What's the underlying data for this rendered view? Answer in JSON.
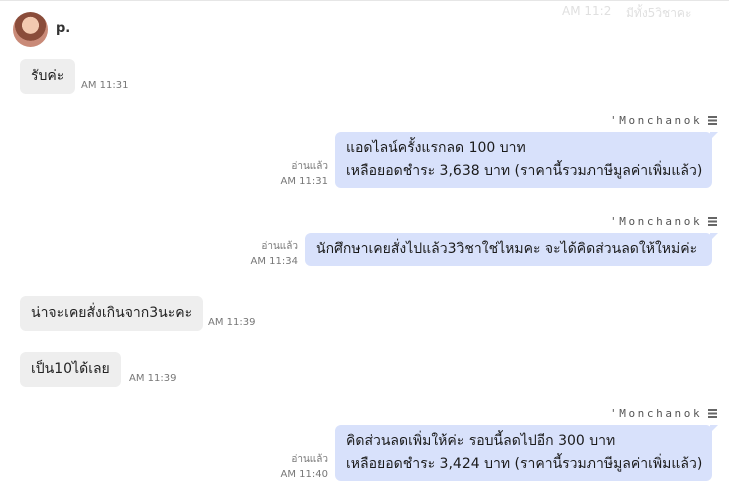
{
  "contact": {
    "name": "p."
  },
  "header_ghost": {
    "left_text": "AM 11:2",
    "right_text": "มีทั้ง5วิชาคะ"
  },
  "messages": [
    {
      "side": "left",
      "lines": [
        "รับค่ะ"
      ],
      "time": "AM 11:31"
    },
    {
      "side": "right",
      "agent": "'Monchanok",
      "read": "อ่านแล้ว",
      "time": "AM 11:31",
      "lines": [
        "แอดไลน์ครั้งแรกลด 100 บาท",
        "เหลือยอดชำระ 3,638 บาท (ราคานี้รวมภาษีมูลค่าเพิ่มแล้ว)"
      ]
    },
    {
      "side": "right",
      "agent": "'Monchanok",
      "read": "อ่านแล้ว",
      "time": "AM 11:34",
      "lines": [
        "นักศึกษาเคยสั่งไปแล้ว3วิชาใช่ไหมคะ จะได้คิดส่วนลดให้ใหม่ค่ะ"
      ]
    },
    {
      "side": "left",
      "lines": [
        "น่าจะเคยสั่งเกินจาก3นะคะ"
      ],
      "time": "AM 11:39"
    },
    {
      "side": "left",
      "lines": [
        "เป็น10ได้เลย"
      ],
      "time": "AM 11:39"
    },
    {
      "side": "right",
      "agent": "'Monchanok",
      "read": "อ่านแล้ว",
      "time": "AM 11:40",
      "lines": [
        "คิดส่วนลดเพิ่มให้ค่ะ รอบนี้ลดไปอีก 300 บาท",
        "เหลือยอดชำระ 3,424 บาท (ราคานี้รวมภาษีมูลค่าเพิ่มแล้ว)"
      ]
    }
  ],
  "icons": {
    "avatar": "contact-avatar",
    "agent_menu": "menu-icon"
  },
  "colors": {
    "outgoing_bubble": "#d8e1fb",
    "incoming_bubble": "#eeeeee",
    "background": "#ffffff"
  }
}
